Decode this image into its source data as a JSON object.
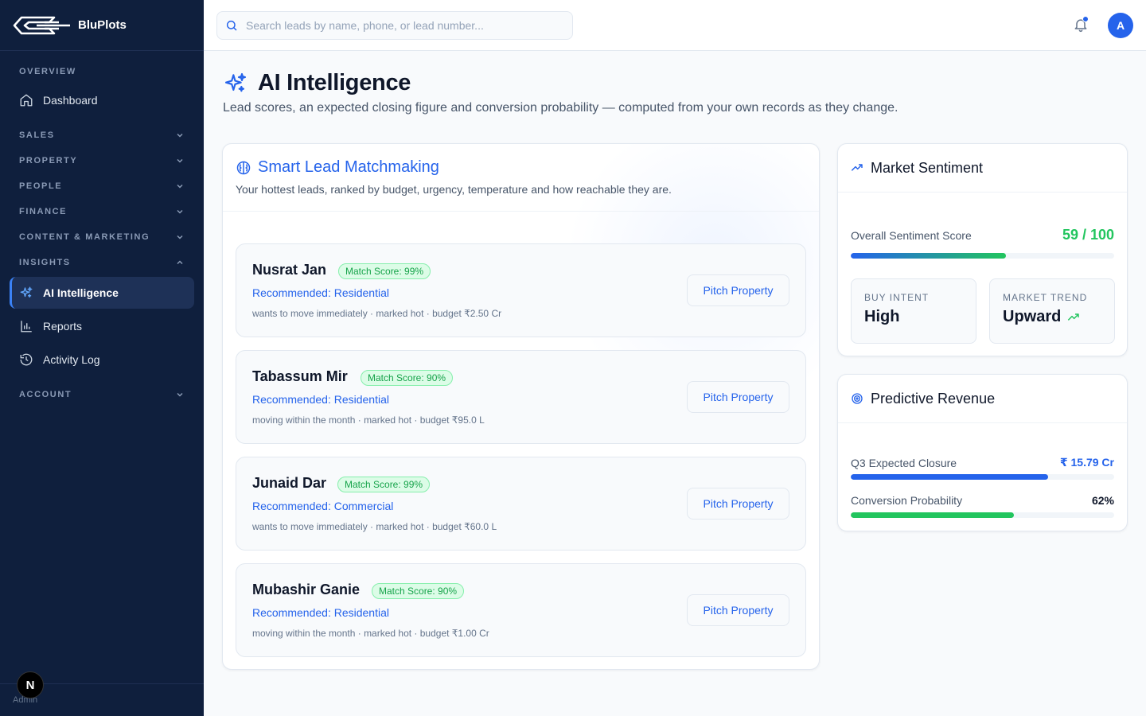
{
  "brand": {
    "name": "BluPlots"
  },
  "sidebar": {
    "overview_label": "OVERVIEW",
    "dashboard": "Dashboard",
    "sections": [
      "SALES",
      "PROPERTY",
      "PEOPLE",
      "FINANCE",
      "CONTENT & MARKETING"
    ],
    "insights_label": "INSIGHTS",
    "insights_items": [
      "AI Intelligence",
      "Reports",
      "Activity Log"
    ],
    "account_label": "ACCOUNT",
    "footer_text": "Admin",
    "badge_letter": "N"
  },
  "header": {
    "search_placeholder": "Search leads by name, phone, or lead number...",
    "avatar_letter": "A"
  },
  "page": {
    "title": "AI Intelligence",
    "subtitle": "Lead scores, an expected closing figure and conversion probability — computed from your own records as they change."
  },
  "matchmaking": {
    "title": "Smart Lead Matchmaking",
    "subtitle": "Your hottest leads, ranked by budget, urgency, temperature and how reachable they are.",
    "pitch_label": "Pitch Property",
    "leads": [
      {
        "name": "Nusrat Jan",
        "match": "Match Score: 99%",
        "recommended": "Recommended: Residential",
        "meta": "wants to move immediately · marked hot · budget ₹2.50 Cr"
      },
      {
        "name": "Tabassum Mir",
        "match": "Match Score: 90%",
        "recommended": "Recommended: Residential",
        "meta": "moving within the month · marked hot · budget ₹95.0 L"
      },
      {
        "name": "Junaid Dar",
        "match": "Match Score: 99%",
        "recommended": "Recommended: Commercial",
        "meta": "wants to move immediately · marked hot · budget ₹60.0 L"
      },
      {
        "name": "Mubashir Ganie",
        "match": "Match Score: 90%",
        "recommended": "Recommended: Residential",
        "meta": "moving within the month · marked hot · budget ₹1.00 Cr"
      }
    ]
  },
  "sentiment": {
    "title": "Market Sentiment",
    "score_label": "Overall Sentiment Score",
    "score_value": "59 / 100",
    "score_fraction": 0.59,
    "buy_intent_label": "BUY INTENT",
    "buy_intent_value": "High",
    "trend_label": "MARKET TREND",
    "trend_value": "Upward"
  },
  "revenue": {
    "title": "Predictive Revenue",
    "closure_label": "Q3 Expected Closure",
    "closure_value": "₹ 15.79 Cr",
    "closure_fraction": 0.75,
    "conversion_label": "Conversion Probability",
    "conversion_value": "62%",
    "conversion_fraction": 0.62
  },
  "colors": {
    "sidebar_bg": "#0f1f3d",
    "accent": "#2563eb",
    "success": "#22c55e"
  }
}
